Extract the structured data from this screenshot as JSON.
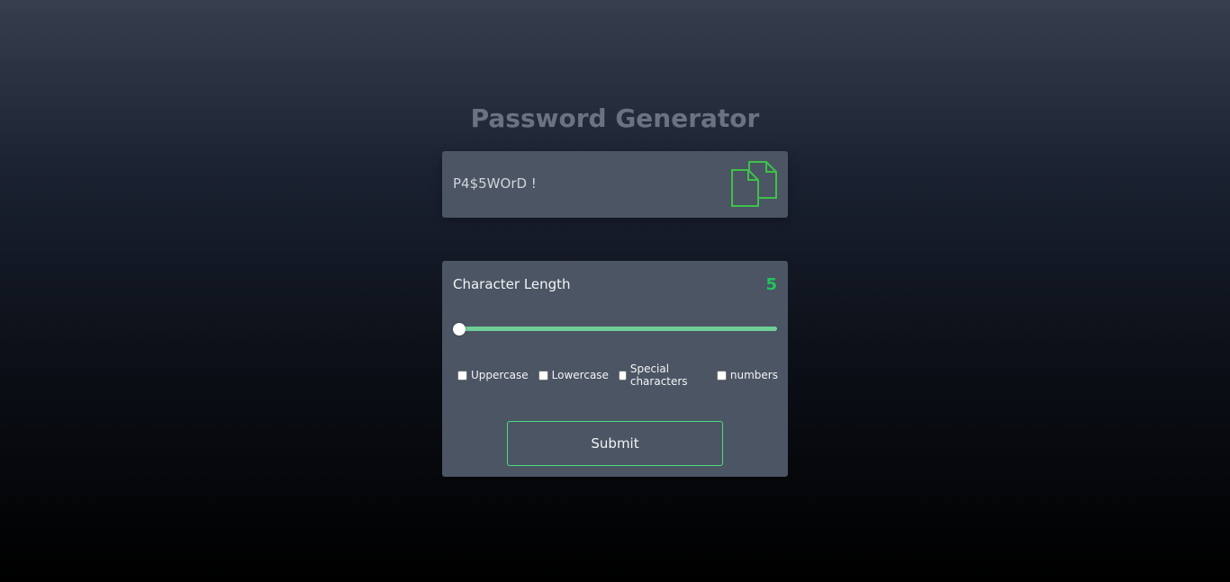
{
  "app": {
    "title": "Password Generator"
  },
  "output": {
    "password": "P4$5WOrD !",
    "copy_icon": "copy-icon"
  },
  "settings": {
    "length_label": "Character Length",
    "length_value": "5",
    "slider_value": 5
  },
  "options": [
    {
      "label": "Uppercase",
      "checked": false
    },
    {
      "label": "Lowercase",
      "checked": false
    },
    {
      "label": "Special characters",
      "checked": false
    },
    {
      "label": "numbers",
      "checked": false
    }
  ],
  "submit": {
    "label": "Submit"
  },
  "colors": {
    "accent": "#22c55e",
    "track": "#6fcf97",
    "panel": "#4b5563",
    "icon_stroke": "#3ec14a"
  }
}
